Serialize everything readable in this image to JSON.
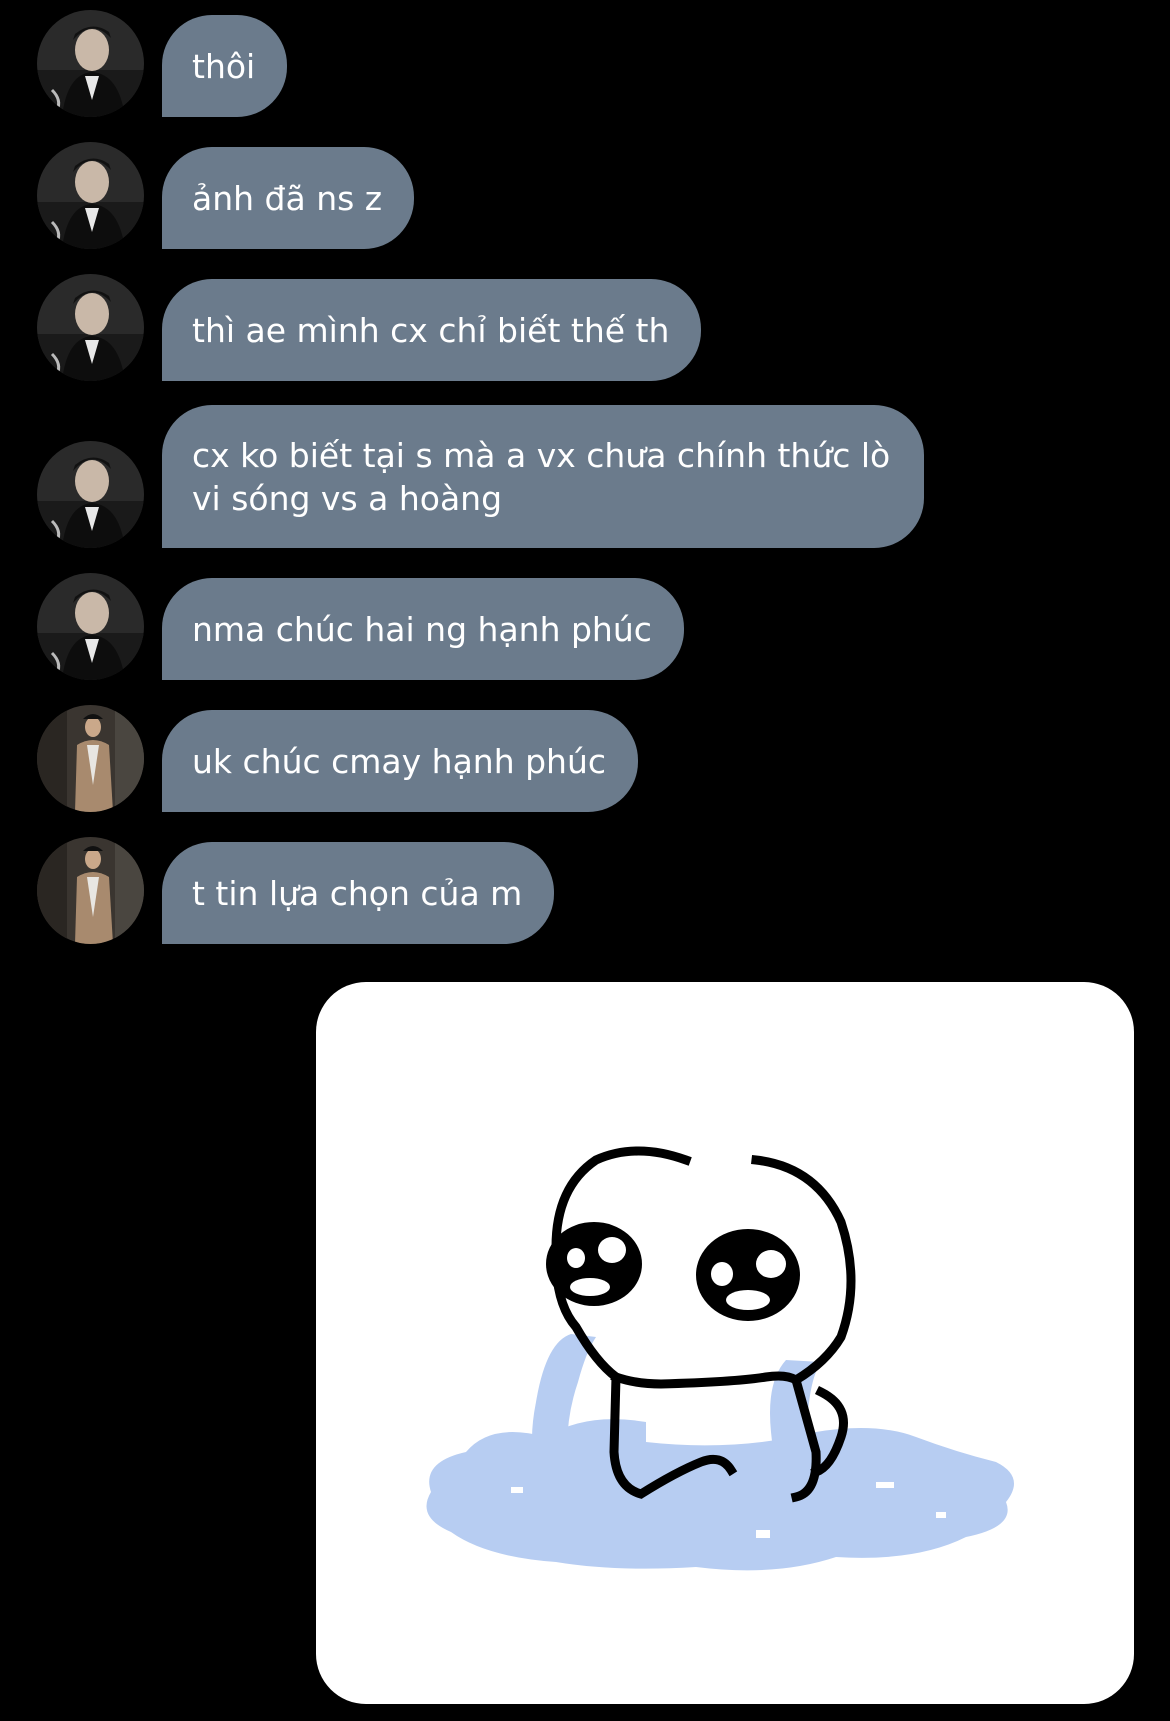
{
  "conversation": {
    "messages": [
      {
        "sender": "friend_a",
        "text": "thôi"
      },
      {
        "sender": "friend_a",
        "text": "ảnh đã ns z"
      },
      {
        "sender": "friend_a",
        "text": "thì ae mình cx chỉ biết thế th"
      },
      {
        "sender": "friend_a",
        "text": "cx ko biết tại s mà a vx chưa chính thức lò vi sóng vs a hoàng"
      },
      {
        "sender": "friend_a",
        "text": "nma chúc hai ng hạnh phúc"
      },
      {
        "sender": "friend_b",
        "text": "uk chúc cmay hạnh phúc"
      },
      {
        "sender": "friend_b",
        "text": "t tin lựa chọn của m"
      }
    ],
    "sticker": {
      "icon": "crying-blob-sticker",
      "tear_color": "#b7cdf2"
    }
  },
  "colors": {
    "background": "#000000",
    "bubble": "#6b7b8c",
    "bubble_text": "#ffffff"
  }
}
